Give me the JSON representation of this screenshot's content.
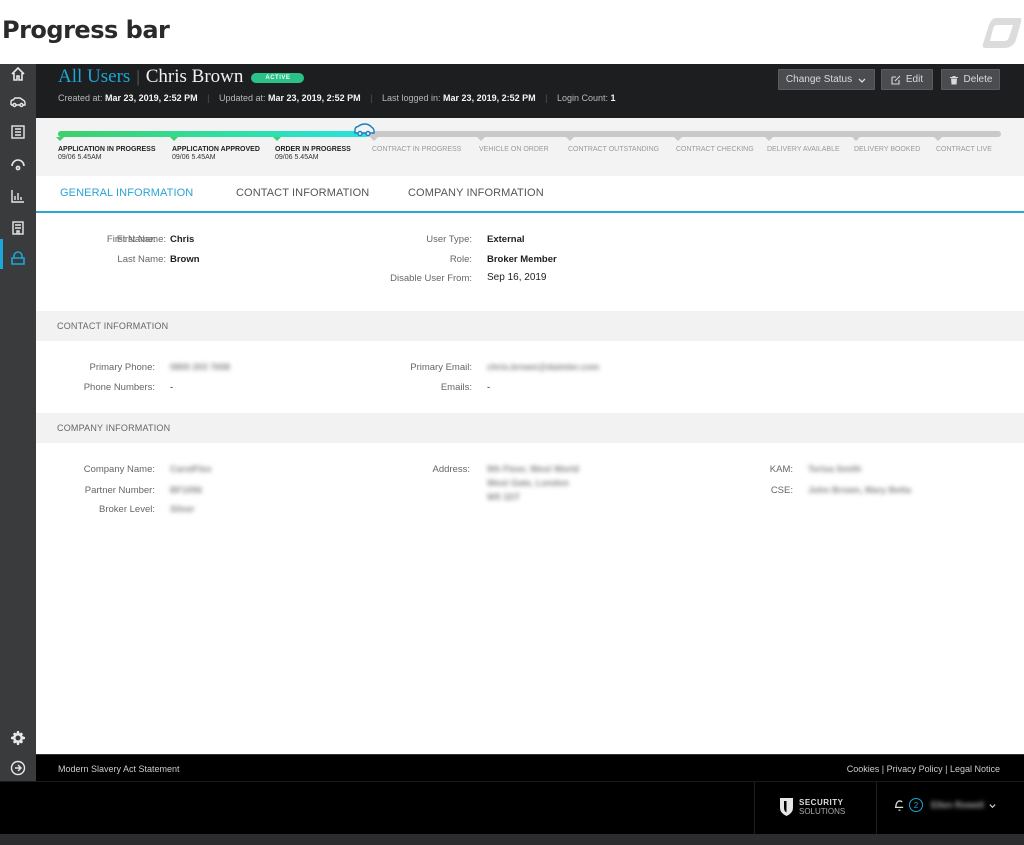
{
  "page_title": "Progress bar",
  "sidebar": {
    "items": [
      {
        "icon": "home-icon"
      },
      {
        "icon": "car-icon"
      },
      {
        "icon": "list-icon"
      },
      {
        "icon": "gauge-icon"
      },
      {
        "icon": "chart-icon"
      },
      {
        "icon": "document-icon"
      },
      {
        "icon": "user-icon",
        "active": true
      }
    ],
    "bottom": [
      {
        "icon": "gear-icon"
      },
      {
        "icon": "logout-icon"
      }
    ]
  },
  "header": {
    "breadcrumb": "All Users",
    "name": "Chris Brown",
    "status_badge": "ACTIVE",
    "meta": {
      "created_label": "Created at:",
      "created_value": "Mar 23, 2019, 2:52 PM",
      "updated_label": "Updated at:",
      "updated_value": "Mar 23, 2019, 2:52 PM",
      "logged_label": "Last logged in:",
      "logged_value": "Mar 23, 2019, 2:52 PM",
      "login_count_label": "Login Count:",
      "login_count_value": "1"
    },
    "buttons": {
      "change_status": "Change Status",
      "edit": "Edit",
      "delete": "Delete"
    }
  },
  "progress": {
    "completed_steps": 3,
    "total_steps": 10,
    "steps": [
      {
        "label": "APPLICATION IN PROGRESS",
        "date": "09/06 5.45AM",
        "done": true
      },
      {
        "label": "APPLICATION APPROVED",
        "date": "09/06 5.45AM",
        "done": true
      },
      {
        "label": "ORDER IN PROGRESS",
        "date": "09/06 5.45AM",
        "done": true
      },
      {
        "label": "CONTRACT IN PROGRESS",
        "date": "",
        "done": false
      },
      {
        "label": "VEHICLE ON ORDER",
        "date": "",
        "done": false
      },
      {
        "label": "CONTRACT OUTSTANDING",
        "date": "",
        "done": false
      },
      {
        "label": "CONTRACT CHECKING",
        "date": "",
        "done": false
      },
      {
        "label": "DELIVERY AVAILABLE",
        "date": "",
        "done": false
      },
      {
        "label": "DELIVERY BOOKED",
        "date": "",
        "done": false
      },
      {
        "label": "CONTRACT LIVE",
        "date": "",
        "done": false
      }
    ]
  },
  "tabs": [
    {
      "label": "GENERAL INFORMATION",
      "active": true
    },
    {
      "label": "CONTACT INFORMATION",
      "active": false
    },
    {
      "label": "COMPANY INFORMATION",
      "active": false
    }
  ],
  "general": {
    "first_name_label": "First Name:",
    "first_name": "Chris",
    "last_name_label": "Last Name:",
    "last_name": "Brown",
    "user_type_label": "User Type:",
    "user_type": "External",
    "role_label": "Role:",
    "role": "Broker Member",
    "disable_label": "Disable User From:",
    "disable_value": "Sep 16, 2019"
  },
  "contact": {
    "section_title": "CONTACT INFORMATION",
    "primary_phone_label": "Primary Phone:",
    "primary_phone": "0800 203 7658",
    "phone_numbers_label": "Phone Numbers:",
    "phone_numbers": "-",
    "primary_email_label": "Primary Email:",
    "primary_email": "chris.brown@daimler.com",
    "emails_label": "Emails:",
    "emails": "-"
  },
  "company": {
    "section_title": "COMPANY INFORMATION",
    "company_name_label": "Company Name:",
    "company_name": "CarotFlex",
    "partner_number_label": "Partner Number:",
    "partner_number": "BF1056",
    "broker_level_label": "Broker Level:",
    "broker_level": "Silver",
    "address_label": "Address:",
    "address_line1": "9th Floor, West World",
    "address_line2": "West Gate, London",
    "address_line3": "W5 1DT",
    "kam_label": "KAM:",
    "kam": "Terisa Smith",
    "cse_label": "CSE:",
    "cse": "John Brown, Mary Betta"
  },
  "footer": {
    "left_link": "Modern Slavery Act Statement",
    "right_links": "Cookies | Privacy Policy | Legal Notice",
    "brand_top": "SECURITY",
    "brand_bottom": "SOLUTIONS",
    "notification_count": "2",
    "user_name": "Ellen Rowell"
  },
  "colors": {
    "accent": "#1ca7d8",
    "active_badge": "#2bc28a",
    "progress_start": "#3fcf6a",
    "progress_end": "#28e1e1",
    "header_bg": "#1d1e20",
    "sidebar_bg": "#3a3b3d"
  }
}
